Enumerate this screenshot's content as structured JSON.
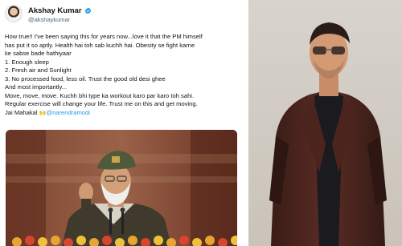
{
  "tweet": {
    "display_name": "Akshay Kumar",
    "handle": "@akshaykumar",
    "verified_icon": "verified-badge-icon",
    "lines": [
      "How true!! I've been saying this for years now...love it that the PM himself",
      "has put it so aptly. Health hai toh sab kuchh hai. Obesity se fight karne",
      "ke sabse bade hathiyaar",
      "1. Enough sleep",
      "2. Fresh air and Sunlight",
      "3. No processed food, less oil. Trust the good old desi ghee",
      "And most importantly...",
      "Move, move, move. Kuchh bhi type ka workout karo par karo toh sahi.",
      "Regular exercise will change your life. Trust me on this and get moving."
    ],
    "last_line_prefix": "Jai Mahakal ",
    "last_line_emoji": "🙌",
    "mention": "@narendramodi"
  },
  "colors": {
    "text": "#0f1419",
    "secondary_text": "#536471",
    "link": "#1d9bf0",
    "verified": "#1d9bf0"
  }
}
